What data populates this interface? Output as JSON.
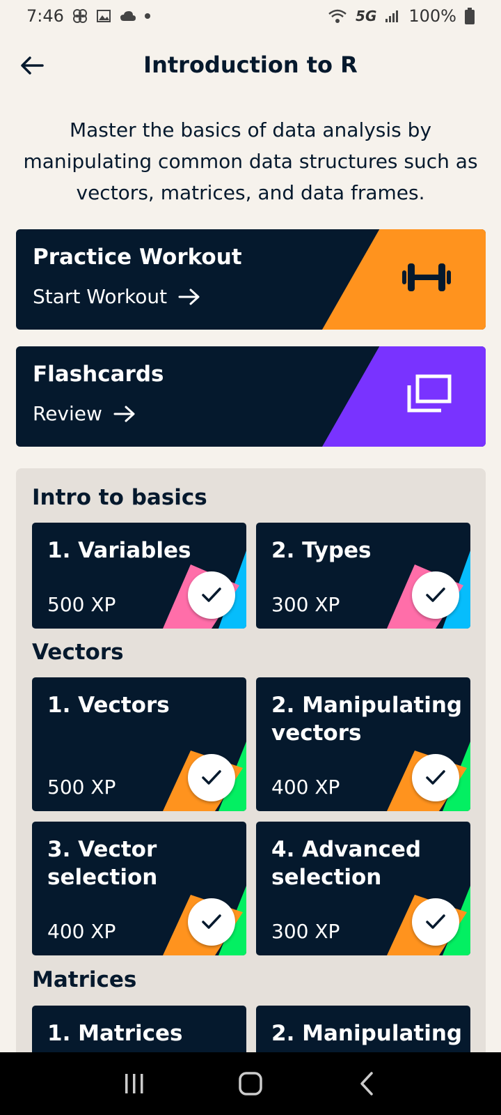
{
  "status_bar": {
    "time": "7:46",
    "network": "5G",
    "battery": "100%"
  },
  "header": {
    "title": "Introduction to R"
  },
  "description": "Master the basics of data analysis by manipulating common data structures such as vectors, matrices, and data frames.",
  "practice": {
    "title": "Practice Workout",
    "action": "Start Workout",
    "icon": "dumbbell-icon",
    "color": "#ff931e"
  },
  "flashcards": {
    "title": "Flashcards",
    "action": "Review",
    "icon": "cards-icon",
    "color": "#7933ff"
  },
  "sections": [
    {
      "title": "Intro to basics",
      "lessons": [
        {
          "title": "1. Variables",
          "xp": "500 XP",
          "completed": true
        },
        {
          "title": "2. Types",
          "xp": "300 XP",
          "completed": true
        }
      ]
    },
    {
      "title": "Vectors",
      "lessons": [
        {
          "title": "1. Vectors",
          "xp": "500 XP",
          "completed": true
        },
        {
          "title": "2. Manipulating vectors",
          "xp": "400 XP",
          "completed": true
        },
        {
          "title": "3. Vector selection",
          "xp": "400 XP",
          "completed": true
        },
        {
          "title": "4. Advanced selection",
          "xp": "300 XP",
          "completed": true
        }
      ]
    },
    {
      "title": "Matrices",
      "lessons": [
        {
          "title": "1. Matrices",
          "xp": "",
          "completed": false
        },
        {
          "title": "2. Manipulating",
          "xp": "",
          "completed": false
        }
      ]
    }
  ],
  "colors": {
    "navy": "#05192d",
    "pink": "#ff6ea9",
    "blue": "#03ef62",
    "orange": "#ff931e",
    "green": "#03ef62",
    "cyan": "#06bdfc"
  }
}
